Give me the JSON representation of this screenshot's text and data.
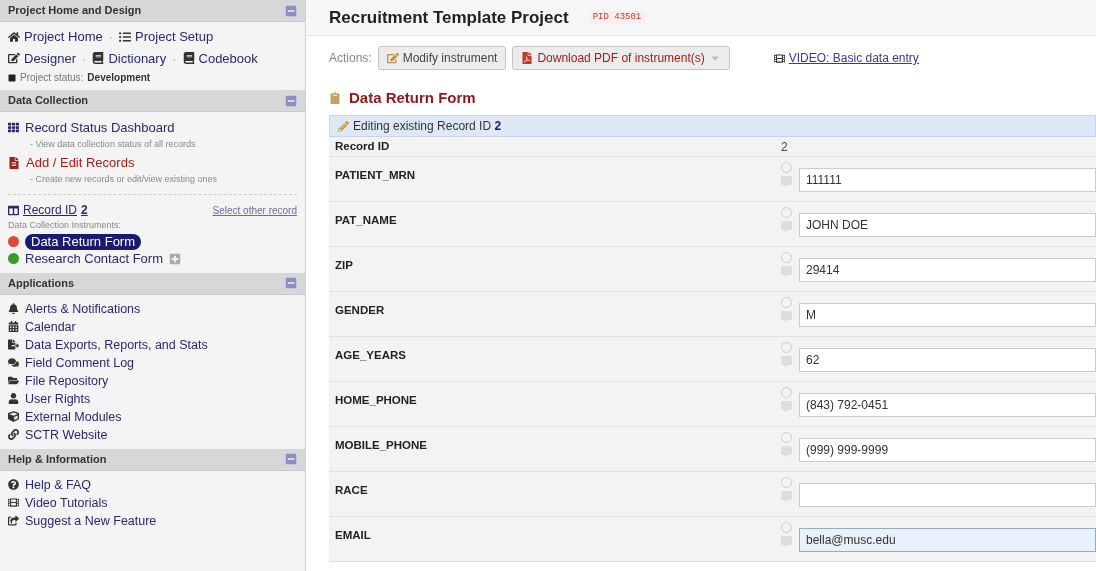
{
  "sidebar": {
    "project": {
      "title": "Project Home and Design",
      "links": [
        [
          {
            "label": "Project Home"
          },
          {
            "label": "Project Setup"
          }
        ],
        [
          {
            "label": "Designer"
          },
          {
            "label": "Dictionary"
          },
          {
            "label": "Codebook"
          }
        ]
      ],
      "separator": "·",
      "status_label": "Project status:",
      "status_value": "Development"
    },
    "collection": {
      "title": "Data Collection",
      "items": [
        {
          "label": "Record Status Dashboard",
          "hint": "- View data collection status of all records",
          "kind": "dashboard"
        },
        {
          "label": "Add / Edit Records",
          "hint": "- Create new records or edit/view existing ones",
          "kind": "records"
        }
      ],
      "record_label": "Record ID",
      "record_id": "2",
      "select_other": "Select other record",
      "instruments_label": "Data Collection Instruments:",
      "instruments": [
        {
          "label": "Data Return Form",
          "color": "#e0463a",
          "selected": true
        },
        {
          "label": "Research Contact Form",
          "color": "#3a9a2e",
          "selected": false
        }
      ]
    },
    "applications": {
      "title": "Applications",
      "items": [
        {
          "label": "Alerts & Notifications"
        },
        {
          "label": "Calendar"
        },
        {
          "label": "Data Exports, Reports, and Stats"
        },
        {
          "label": "Field Comment Log"
        },
        {
          "label": "File Repository"
        },
        {
          "label": "User Rights"
        },
        {
          "label": "External Modules"
        },
        {
          "label": "SCTR Website"
        }
      ]
    },
    "help": {
      "title": "Help & Information",
      "items": [
        {
          "label": "Help & FAQ"
        },
        {
          "label": "Video Tutorials"
        },
        {
          "label": "Suggest a New Feature"
        }
      ]
    }
  },
  "header": {
    "title": "Recruitment Template Project",
    "pid": "PID 43501"
  },
  "actions": {
    "label": "Actions:",
    "buttons": [
      {
        "label": "Modify instrument",
        "kind": "modify"
      },
      {
        "label": "Download PDF of instrument(s)",
        "kind": "pdf"
      }
    ],
    "video_link": "VIDEO: Basic data entry"
  },
  "form": {
    "title": "Data Return Form",
    "editing_text": "Editing existing Record ID",
    "editing_id": "2",
    "record_row": {
      "label": "Record ID",
      "value": "2"
    },
    "fields": [
      {
        "label": "PATIENT_MRN",
        "value": "111111",
        "focused": false
      },
      {
        "label": "PAT_NAME",
        "value": "JOHN DOE",
        "focused": false
      },
      {
        "label": "ZIP",
        "value": "29414",
        "focused": false
      },
      {
        "label": "GENDER",
        "value": "M",
        "focused": false
      },
      {
        "label": "AGE_YEARS",
        "value": "62",
        "focused": false
      },
      {
        "label": "HOME_PHONE",
        "value": "(843) 792-0451",
        "focused": false
      },
      {
        "label": "MOBILE_PHONE",
        "value": "(999) 999-9999",
        "focused": false
      },
      {
        "label": "RACE",
        "focused": false
      },
      {
        "label": "EMAIL",
        "value": "bella@musc.edu",
        "focused": true
      }
    ]
  }
}
